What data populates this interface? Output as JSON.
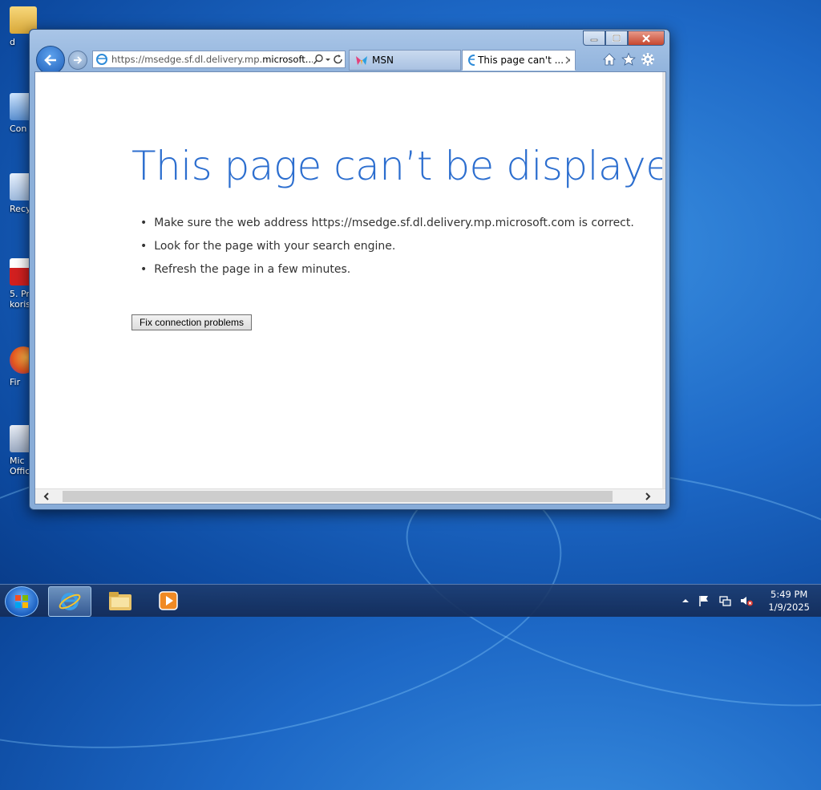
{
  "desktop": {
    "icons": [
      {
        "label": "d"
      },
      {
        "label": "Con"
      },
      {
        "label": "Recy"
      },
      {
        "label": "5. Pr",
        "label2": "korisc"
      },
      {
        "label": "Fir"
      },
      {
        "label": "Mic",
        "label2": "Offic"
      }
    ]
  },
  "window": {
    "address_url_prefix": "https://msedge.sf.dl.delivery.mp.",
    "address_url_domain": "microsoft...",
    "tabs": [
      {
        "label": "MSN"
      },
      {
        "label": "This page can't ..."
      }
    ]
  },
  "page": {
    "heading": "This page can’t be displayed",
    "tips": [
      "Make sure the web address https://msedge.sf.dl.delivery.mp.microsoft.com is correct.",
      "Look for the page with your search engine.",
      "Refresh the page in a few minutes."
    ],
    "fix_button": "Fix connection problems"
  },
  "taskbar": {
    "time": "5:49 PM",
    "date": "1/9/2025"
  },
  "colors": {
    "heading": "#2c6ecf",
    "desktop": "#1d68c6"
  }
}
